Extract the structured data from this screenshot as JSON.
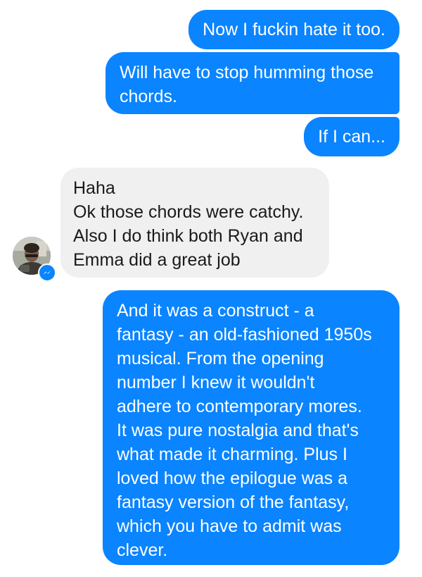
{
  "messages": [
    {
      "direction": "outgoing",
      "text": "Now I fuckin hate it too."
    },
    {
      "direction": "outgoing",
      "text": "Will have to stop humming those\nchords."
    },
    {
      "direction": "outgoing",
      "text": "If I can..."
    },
    {
      "direction": "incoming",
      "text": "Haha\nOk those chords were catchy.\nAlso I do think both Ryan and\nEmma did a great job"
    },
    {
      "direction": "outgoing",
      "text": "And it was a construct - a\nfantasy - an old-fashioned 1950s\nmusical. From the opening\nnumber I knew it wouldn't\nadhere to contemporary mores.\nIt was pure nostalgia and that's\nwhat made it charming. Plus I\nloved how the epilogue was a\nfantasy version of the fantasy,\nwhich you have to admit was\nclever."
    }
  ],
  "contact": {
    "avatar_icon": "profile-photo",
    "badge_icon": "messenger-icon"
  },
  "colors": {
    "outgoing_bubble": "#0a84ff",
    "incoming_bubble": "#f0f0f0",
    "outgoing_text": "#ffffff",
    "incoming_text": "#1a1a1a"
  }
}
